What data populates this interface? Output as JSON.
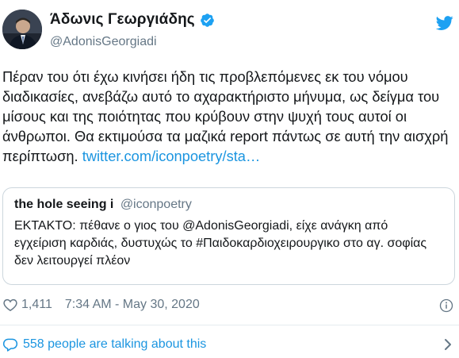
{
  "author": {
    "display_name": "Άδωνις Γεωργιάδης",
    "handle": "@AdonisGeorgiadi",
    "verified": true
  },
  "tweet": {
    "text": "Πέραν του ότι έχω κινήσει ήδη τις προβλεπόμενες εκ του νόμου διαδικασίες, ανεβάζω αυτό το αχαρακτήριστο μήνυμα, ως δείγμα του μίσους και της ποιότητας που κρύβουν στην ψυχή τους αυτοί οι άνθρωποι. Θα εκτιμούσα τα μαζικά report πάντως σε αυτή την αισχρή περίπτωση.",
    "link": "twitter.com/iconpoetry/sta…"
  },
  "quoted": {
    "display_name": "the hole seeing i",
    "handle": "@iconpoetry",
    "text": "ΕΚΤΑΚΤΟ: πέθανε ο γιος του @AdonisGeorgiadi, είχε ανάγκη από εγχείριση καρδιάς, δυστυχώς το #Παιδοκαρδιοχειρουργικο στο αγ. σοφίας δεν λειτουργεί πλέον"
  },
  "meta": {
    "likes": "1,411",
    "timestamp": "7:34 AM - May 30, 2020"
  },
  "footer": {
    "talking": "558 people are talking about this"
  },
  "icons": {
    "verified": "verified-badge-icon",
    "bird": "twitter-bird-icon",
    "heart": "heart-icon",
    "info": "info-icon",
    "talk": "speech-bubble-icon",
    "chevron": "chevron-right-icon"
  },
  "colors": {
    "accent": "#1da1f2",
    "link": "#1b95e0",
    "secondary_text": "#657786",
    "border": "#ccd6dd"
  }
}
